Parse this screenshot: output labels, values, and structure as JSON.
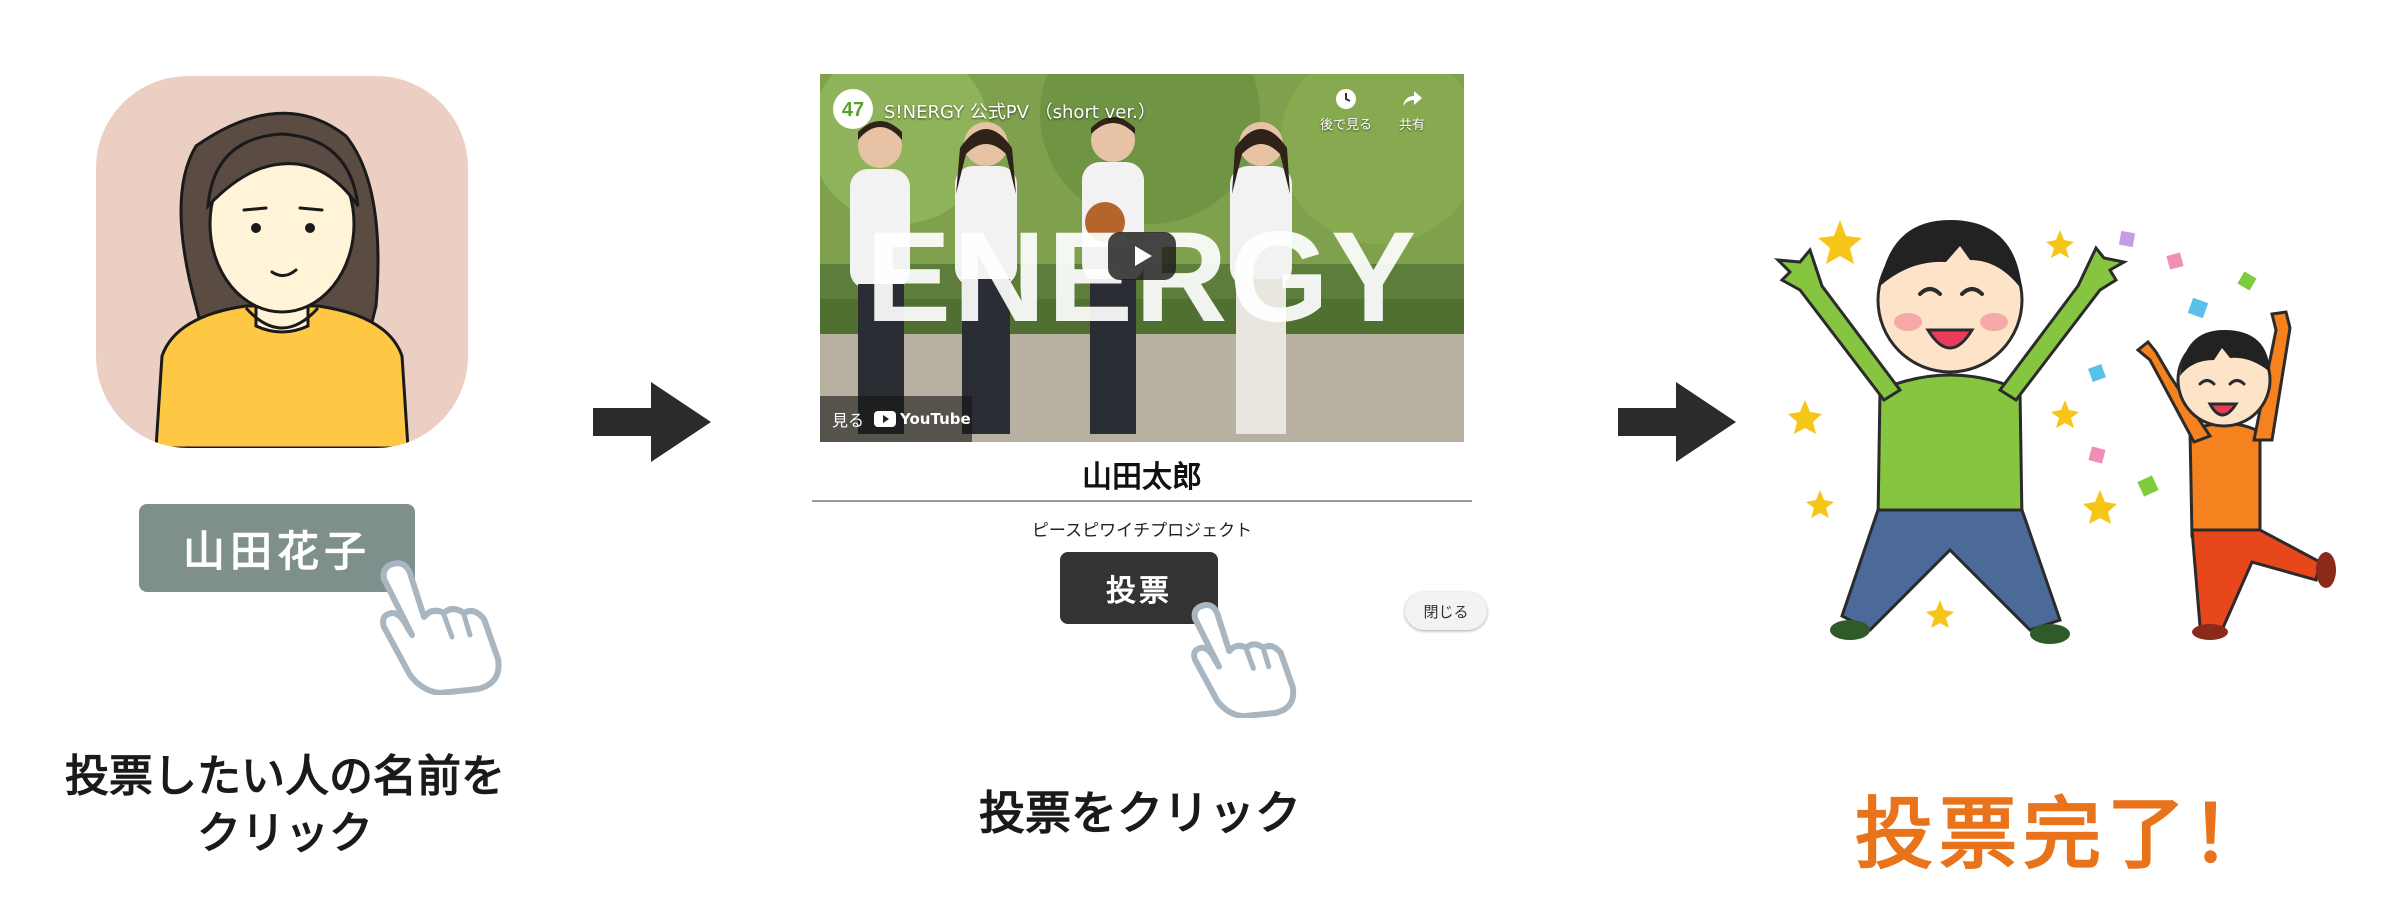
{
  "step1": {
    "name_chip": "山田花子",
    "caption_line1": "投票したい人の名前を",
    "caption_line2": "クリック"
  },
  "step2": {
    "video": {
      "title": "S!NERGY 公式PV （short ver.）",
      "channel_logo": "47",
      "watch_later": "後で見る",
      "share": "共有",
      "overlay_text": "ENERGY",
      "watch_on": "見る",
      "youtube": "YouTube"
    },
    "candidate_name": "山田太郎",
    "candidate_project": "ピースピワイチプロジェクト",
    "vote_button": "投票",
    "close_button": "閉じる",
    "caption": "投票をクリック"
  },
  "step3": {
    "caption": "投票完了！"
  },
  "colors": {
    "avatar_bg": "#ebcfc2",
    "name_chip_bg": "#7f8f8b",
    "vote_button_bg": "#333333",
    "arrow": "#2b2b2b",
    "done_text": "#e8731a"
  }
}
